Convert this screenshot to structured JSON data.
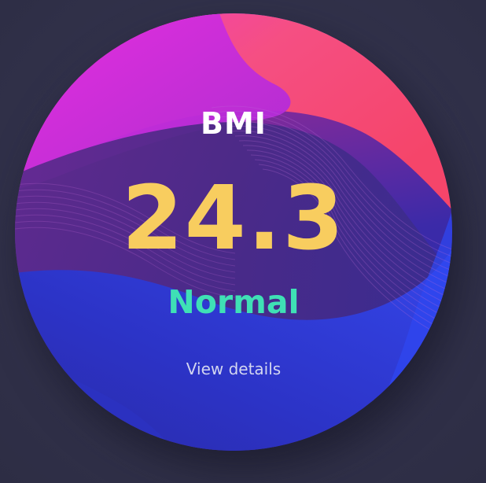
{
  "widget": {
    "title": "BMI",
    "value": "24.3",
    "status": "Normal",
    "link_label": "View details"
  },
  "colors": {
    "background": "#32324a",
    "value": "#f8cd5f",
    "status": "#3fe0b5",
    "link": "#d3d6f0"
  }
}
